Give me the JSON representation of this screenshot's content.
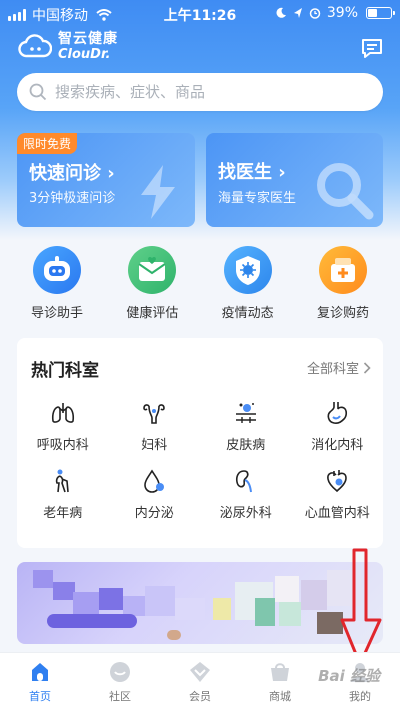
{
  "status_bar": {
    "carrier": "中国移动",
    "time": "上午11:26",
    "battery_percent": "39%",
    "battery_level": 0.39
  },
  "header": {
    "logo_cn": "智云健康",
    "logo_en": "ClouDr."
  },
  "search": {
    "placeholder": "搜索疾病、症状、商品"
  },
  "promo_cards": [
    {
      "badge": "限时免费",
      "title": "快速问诊 ›",
      "subtitle": "3分钟极速问诊"
    },
    {
      "title": "找医生 ›",
      "subtitle": "海量专家医生"
    }
  ],
  "quick_menu": [
    {
      "label": "导诊助手",
      "icon": "robot-assistant-icon"
    },
    {
      "label": "健康评估",
      "icon": "health-assessment-icon"
    },
    {
      "label": "疫情动态",
      "icon": "virus-shield-icon"
    },
    {
      "label": "复诊购药",
      "icon": "medicine-box-icon"
    }
  ],
  "departments": {
    "title": "热门科室",
    "all_label": "全部科室",
    "items": [
      {
        "label": "呼吸内科",
        "icon": "lungs-icon"
      },
      {
        "label": "妇科",
        "icon": "uterus-icon"
      },
      {
        "label": "皮肤病",
        "icon": "skin-icon"
      },
      {
        "label": "消化内科",
        "icon": "stomach-icon"
      },
      {
        "label": "老年病",
        "icon": "elderly-icon"
      },
      {
        "label": "内分泌",
        "icon": "drop-icon"
      },
      {
        "label": "泌尿外科",
        "icon": "kidney-icon"
      },
      {
        "label": "心血管内科",
        "icon": "heart-icon"
      }
    ]
  },
  "bottom_nav": [
    {
      "label": "首页",
      "icon": "home-icon",
      "active": true
    },
    {
      "label": "社区",
      "icon": "community-icon",
      "active": false
    },
    {
      "label": "会员",
      "icon": "member-icon",
      "active": false
    },
    {
      "label": "商城",
      "icon": "shop-icon",
      "active": false
    },
    {
      "label": "我的",
      "icon": "profile-icon",
      "active": false
    }
  ],
  "watermark": "Bai 经验",
  "colors": {
    "primary": "#3f8cf3",
    "badge": "#ff8a2b",
    "annotation": "#e1262c"
  }
}
